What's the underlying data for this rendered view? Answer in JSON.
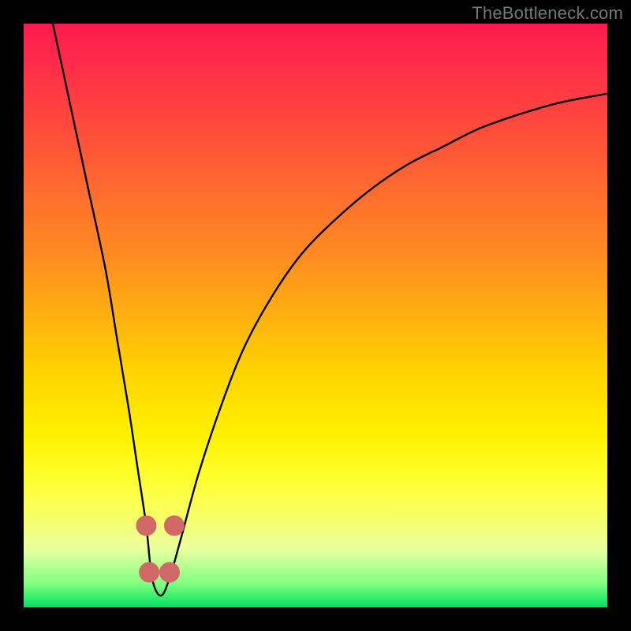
{
  "watermark": "TheBottleneck.com",
  "chart_data": {
    "type": "line",
    "title": "",
    "xlabel": "",
    "ylabel": "",
    "xlim": [
      0,
      100
    ],
    "ylim": [
      0,
      100
    ],
    "series": [
      {
        "name": "bottleneck-curve",
        "x": [
          5,
          8,
          11,
          14,
          16,
          18,
          19.5,
          21,
          22,
          23.5,
          25,
          27,
          30,
          34,
          38,
          43,
          48,
          54,
          60,
          66,
          72,
          78,
          85,
          92,
          100
        ],
        "values": [
          100,
          86,
          72,
          58,
          46,
          34,
          24,
          14,
          5,
          2,
          5,
          12,
          23,
          35,
          45,
          54,
          61,
          67,
          72,
          76,
          79,
          82,
          84.5,
          86.5,
          88
        ]
      }
    ],
    "markers": [
      {
        "name": "marker-a",
        "x": 21.0,
        "y": 14,
        "color": "#d06868"
      },
      {
        "name": "marker-b",
        "x": 21.5,
        "y": 6,
        "color": "#d06868"
      },
      {
        "name": "marker-c",
        "x": 25.0,
        "y": 6,
        "color": "#d06868"
      },
      {
        "name": "marker-d",
        "x": 25.8,
        "y": 14,
        "color": "#d06868"
      }
    ],
    "background_gradient": {
      "top": "#ff1a4d",
      "mid": "#ffd400",
      "bottom": "#00e060"
    }
  }
}
